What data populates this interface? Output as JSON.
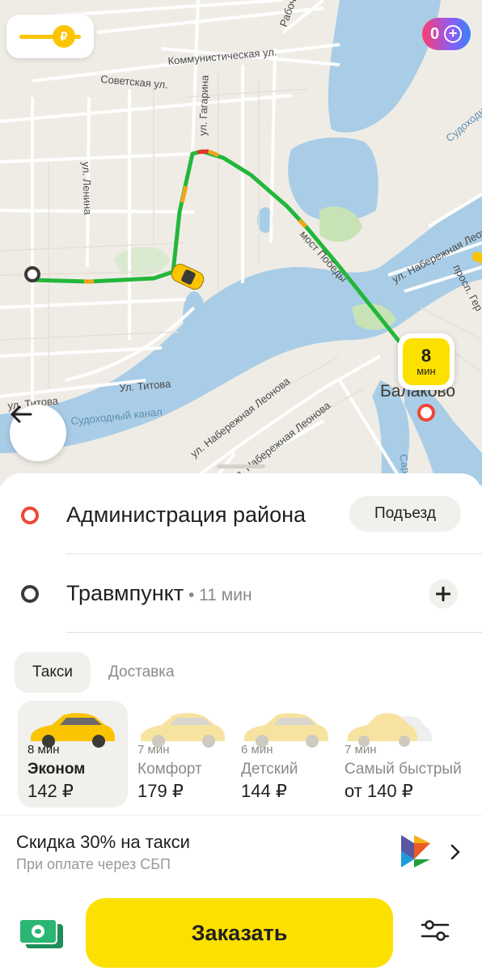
{
  "map": {
    "streets": {
      "kommunisticheskaya": "Коммунистическая ул.",
      "sovetskaya": "Советская ул.",
      "gagarina": "ул. Гагарина",
      "lenina": "ул. Ленина",
      "titova_1": "Ул. Титова",
      "titova_2": "ул. Титова",
      "kanal": "Судоходный канал",
      "leonova": "ул. Набережная Леонова",
      "leonova_2": "ул. Набережная Леонова",
      "most": "мост Победы",
      "naberezhnaya": "ул. Набережная Леонова",
      "prosp": "просп. Гер",
      "rabochaya": "Рабоч",
      "sudohod_right": "Судоходн",
      "sar": "Сар"
    },
    "city_label": "Балаково",
    "eta_marker": {
      "value": "8",
      "unit": "мин"
    },
    "plus_points": "0",
    "route_color": "#22b73b",
    "jam_colors": {
      "slow": "#f2a517",
      "jam": "#e0362c"
    }
  },
  "route": {
    "from": {
      "label": "Администрация района",
      "action": "Подъезд"
    },
    "to": {
      "label": "Травмпункт",
      "duration": " • 11 мин"
    }
  },
  "tabs": [
    {
      "label": "Такси",
      "active": true
    },
    {
      "label": "Доставка",
      "active": false
    }
  ],
  "tariffs": [
    {
      "eta": "8 мин",
      "name": "Эконом",
      "price": "142 ₽",
      "selected": true
    },
    {
      "eta": "7 мин",
      "name": "Комфорт",
      "price": "179 ₽",
      "selected": false
    },
    {
      "eta": "6 мин",
      "name": "Детский",
      "price": "144 ₽",
      "selected": false
    },
    {
      "eta": "7 мин",
      "name": "Самый быстрый",
      "price": "от 140 ₽",
      "selected": false
    }
  ],
  "promo": {
    "title": "Скидка 30% на такси",
    "subtitle": "При оплате через СБП"
  },
  "order_button": "Заказать",
  "colors": {
    "accent": "#fce000",
    "brand_yellow": "#fbc400"
  }
}
